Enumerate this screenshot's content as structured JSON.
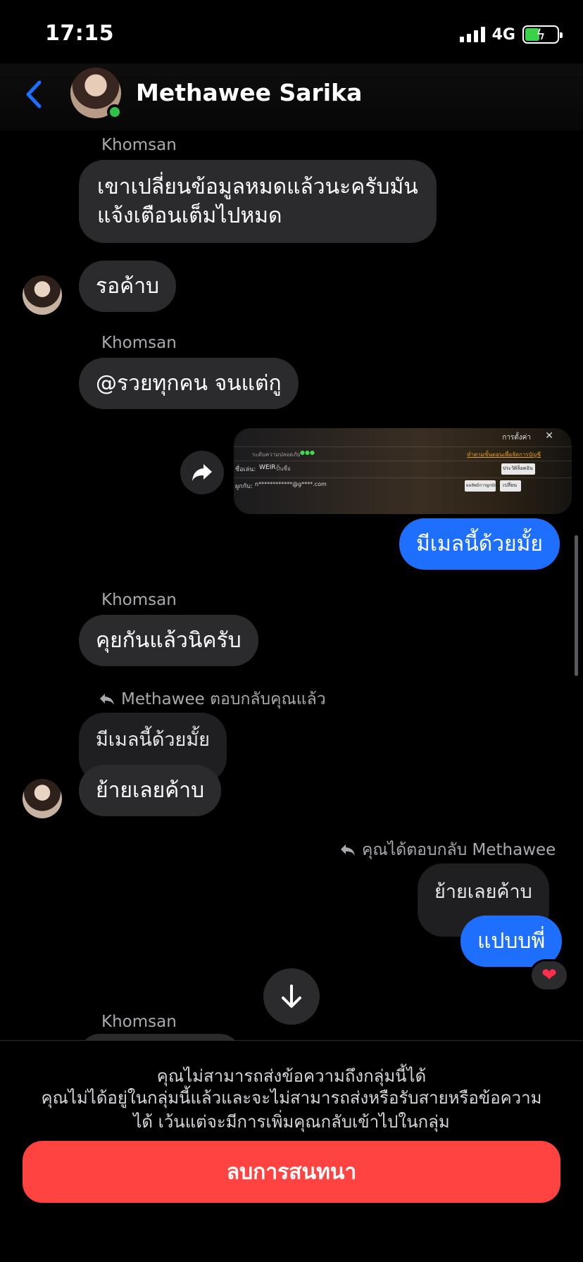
{
  "status": {
    "time": "17:15",
    "network": "4G",
    "battery_level": 0.45
  },
  "header": {
    "name": "Methawee Sarika"
  },
  "messages": {
    "m1_sender": "Khomsan",
    "m1_line1": "เขาเปลี่ยนข้อมูลหมดแล้วนะครับมัน",
    "m1_line2": "แจ้งเตือนเต็มไปหมด",
    "m2_text": "รอค้าบ",
    "m3_sender": "Khomsan",
    "m3_text": "@รวยทุกคน จนแต่กู",
    "m4_text": "มีเมลนี้ด้วยมั้ย",
    "m5_sender": "Khomsan",
    "m5_text": "คุยกันแล้วนิครับ",
    "m6_reply_note": "Methawee ตอบกลับคุณแล้ว",
    "m6_quote": "มีเมลนี้ด้วยมั้ย",
    "m6_text": "ย้ายเลยค้าบ",
    "m7_reply_note": "คุณได้ตอบกลับ Methawee",
    "m7_quote": "ย้ายเลยค้าบ",
    "m7_text": "แปบบพี่",
    "m7_reaction": "❤",
    "m8_sender": "Khomsan"
  },
  "shared_image": {
    "menu_label": "การตั้งค่า",
    "row1_label": "ระดับความปลอดภัย",
    "row1_status": "●●●",
    "row1_link": "ทำตามขั้นตอนเพื่อจัดการบัญชี",
    "row2_label": "ชื่อเล่น:",
    "row2_value": "WEIR",
    "row2_hint": "ปั้นชื่อ",
    "row2_button": "ประวัติล็อคอิน",
    "row3_label": "ผูกกับ:",
    "row3_value": "n************@g****.com",
    "row3_button1": "ผลลัพธ์การผูกบัญชี",
    "row3_button2": "เปลี่ยน"
  },
  "footer": {
    "title": "คุณไม่สามารถส่งข้อความถึงกลุ่มนี้ได้",
    "desc_line1": "คุณไม่ได้อยู่ในกลุ่มนี้แล้วและจะไม่สามารถส่งหรือรับสายหรือข้อความ",
    "desc_line2": "ได้ เว้นแต่จะมีการเพิ่มคุณกลับเข้าไปในกลุ่ม",
    "delete_label": "ลบการสนทนา"
  },
  "colors": {
    "accent_blue": "#1f6fff",
    "delete_red": "#ff4340",
    "online_green": "#31c24d"
  }
}
